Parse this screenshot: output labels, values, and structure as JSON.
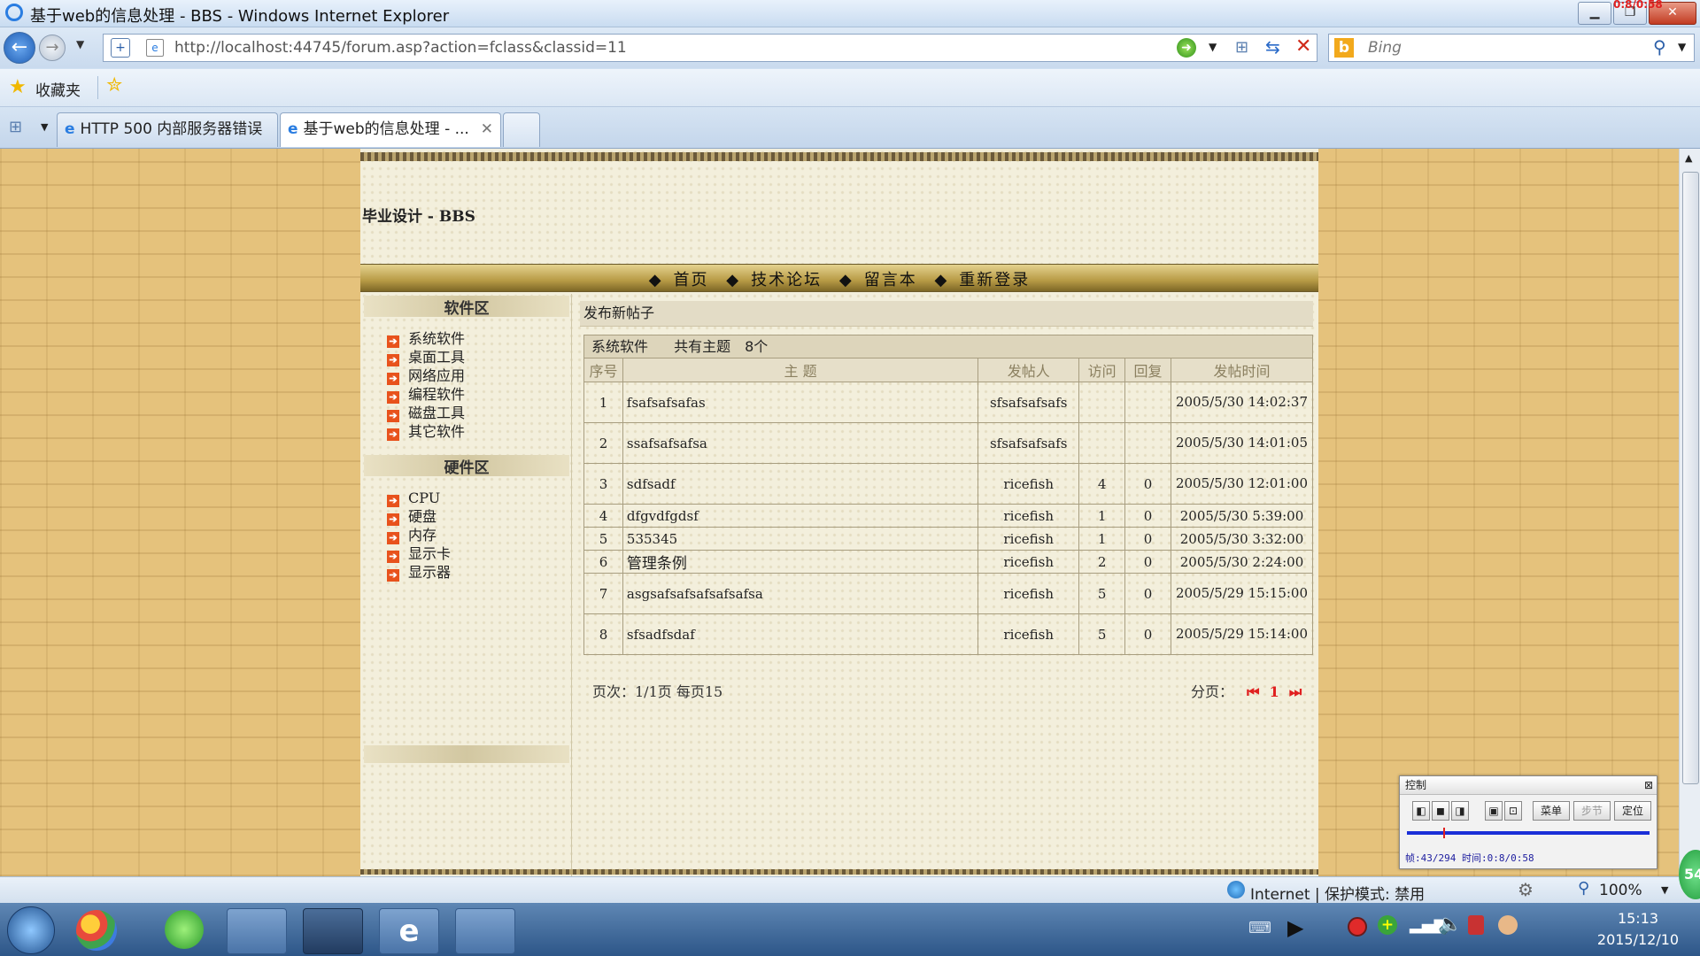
{
  "window": {
    "title": "基于web的信息处理 - BBS - Windows Internet Explorer",
    "overlay_timer": "0:8/0:58"
  },
  "browser": {
    "url": "http://localhost:44745/forum.asp?action=fclass&classid=11",
    "search_placeholder": "Bing",
    "favorites_label": "收藏夹",
    "tabs": [
      {
        "label": "HTTP 500 内部服务器错误"
      },
      {
        "label": "基于web的信息处理 - ..."
      }
    ]
  },
  "site": {
    "title": "毕业设计 - BBS",
    "nav": [
      "首页",
      "技术论坛",
      "留言本",
      "重新登录"
    ]
  },
  "sidebar": {
    "software_heading": "软件区",
    "software_items": [
      "系统软件",
      "桌面工具",
      "网络应用",
      "编程软件",
      "磁盘工具",
      "其它软件"
    ],
    "hardware_heading": "硬件区",
    "hardware_items": [
      "CPU",
      "硬盘",
      "内存",
      "显示卡",
      "显示器"
    ]
  },
  "forum": {
    "post_new": "发布新帖子",
    "category": "系统软件",
    "topic_count": "共有主题　8个",
    "columns": [
      "序号",
      "主 题",
      "发帖人",
      "访问",
      "回复",
      "发帖时间"
    ],
    "rows": [
      {
        "no": "1",
        "subject": "fsafsafsafas",
        "author": "sfsafsafsafs",
        "visits": "",
        "replies": "",
        "time": "2005/5/30 14:02:37",
        "tall": true
      },
      {
        "no": "2",
        "subject": "ssafsafsafsa",
        "author": "sfsafsafsafs",
        "visits": "",
        "replies": "",
        "time": "2005/5/30 14:01:05",
        "tall": true
      },
      {
        "no": "3",
        "subject": "sdfsadf",
        "author": "ricefish",
        "visits": "4",
        "replies": "0",
        "time": "2005/5/30 12:01:00",
        "tall": true
      },
      {
        "no": "4",
        "subject": "dfgvdfgdsf",
        "author": "ricefish",
        "visits": "1",
        "replies": "0",
        "time": "2005/5/30 5:39:00",
        "tall": false
      },
      {
        "no": "5",
        "subject": "535345",
        "author": "ricefish",
        "visits": "1",
        "replies": "0",
        "time": "2005/5/30 3:32:00",
        "tall": false
      },
      {
        "no": "6",
        "subject": "管理条例",
        "author": "ricefish",
        "visits": "2",
        "replies": "0",
        "time": "2005/5/30 2:24:00",
        "tall": false
      },
      {
        "no": "7",
        "subject": "asgsafsafsafsafsafsa",
        "author": "ricefish",
        "visits": "5",
        "replies": "0",
        "time": "2005/5/29 15:15:00",
        "tall": true
      },
      {
        "no": "8",
        "subject": "sfsadfsdaf",
        "author": "ricefish",
        "visits": "5",
        "replies": "0",
        "time": "2005/5/29 15:14:00",
        "tall": true
      }
    ],
    "page_info": "页次：1/1页 每页15",
    "pager_label": "分页：",
    "pager_current": "1"
  },
  "status": {
    "zone": "Internet | 保护模式: 禁用",
    "zoom": "100%"
  },
  "taskbar": {
    "time": "15:13",
    "date": "2015/12/10"
  },
  "control_panel": {
    "title": "控制",
    "buttons": [
      "菜单",
      "步节",
      "定位"
    ],
    "progress": 0.15,
    "readout": "帧:43/294 时间:0:8/0:58"
  },
  "badge": "54",
  "colors": {
    "accent_red": "#e02020",
    "arrow_orange": "#e8521c",
    "page_bg": "#e5c27c"
  }
}
